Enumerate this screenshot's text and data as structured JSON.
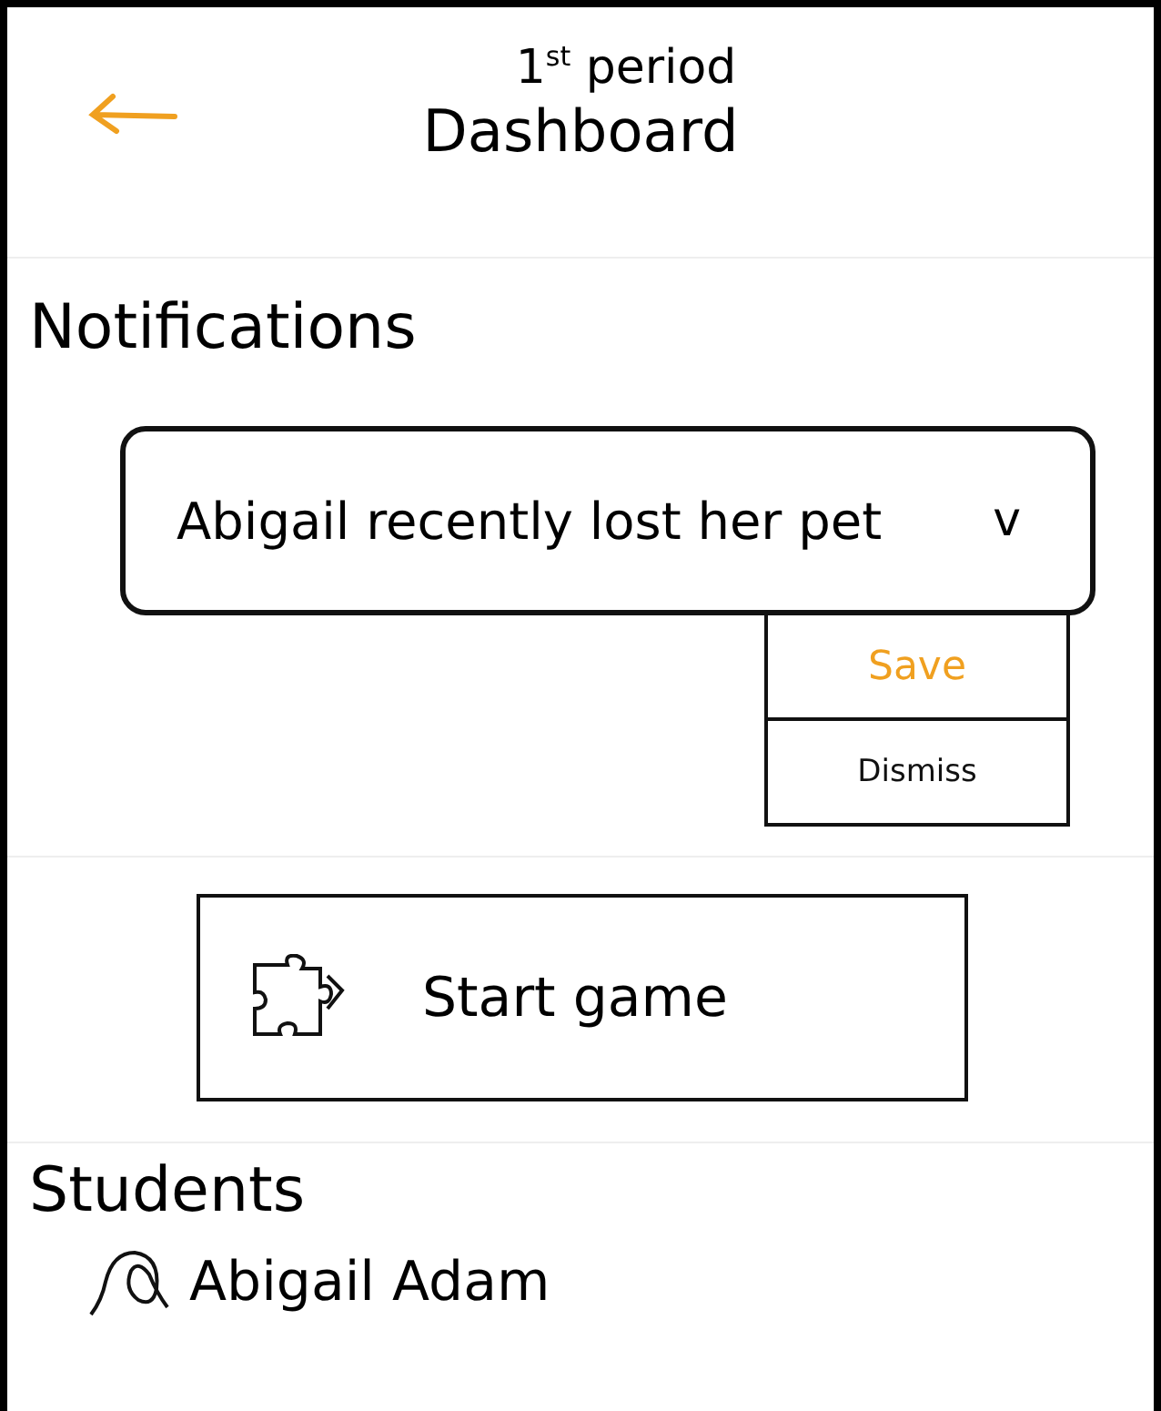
{
  "header": {
    "title": "1$^{st}$ period",
    "subtitle": "Dashboard"
  },
  "notifications": {
    "heading": "Notifications",
    "items": [
      {
        "text": "Abigail recently lost her pet",
        "toggle": "v",
        "expanded": true,
        "menu": [
          {
            "label": "Save",
            "selected": true
          },
          {
            "label": "Dismiss",
            "selected": false
          }
        ]
      }
    ]
  },
  "game_button": {
    "label": "Start game"
  },
  "students": {
    "heading": "Students",
    "items": [
      {
        "name": "Abigail Adam"
      }
    ]
  }
}
